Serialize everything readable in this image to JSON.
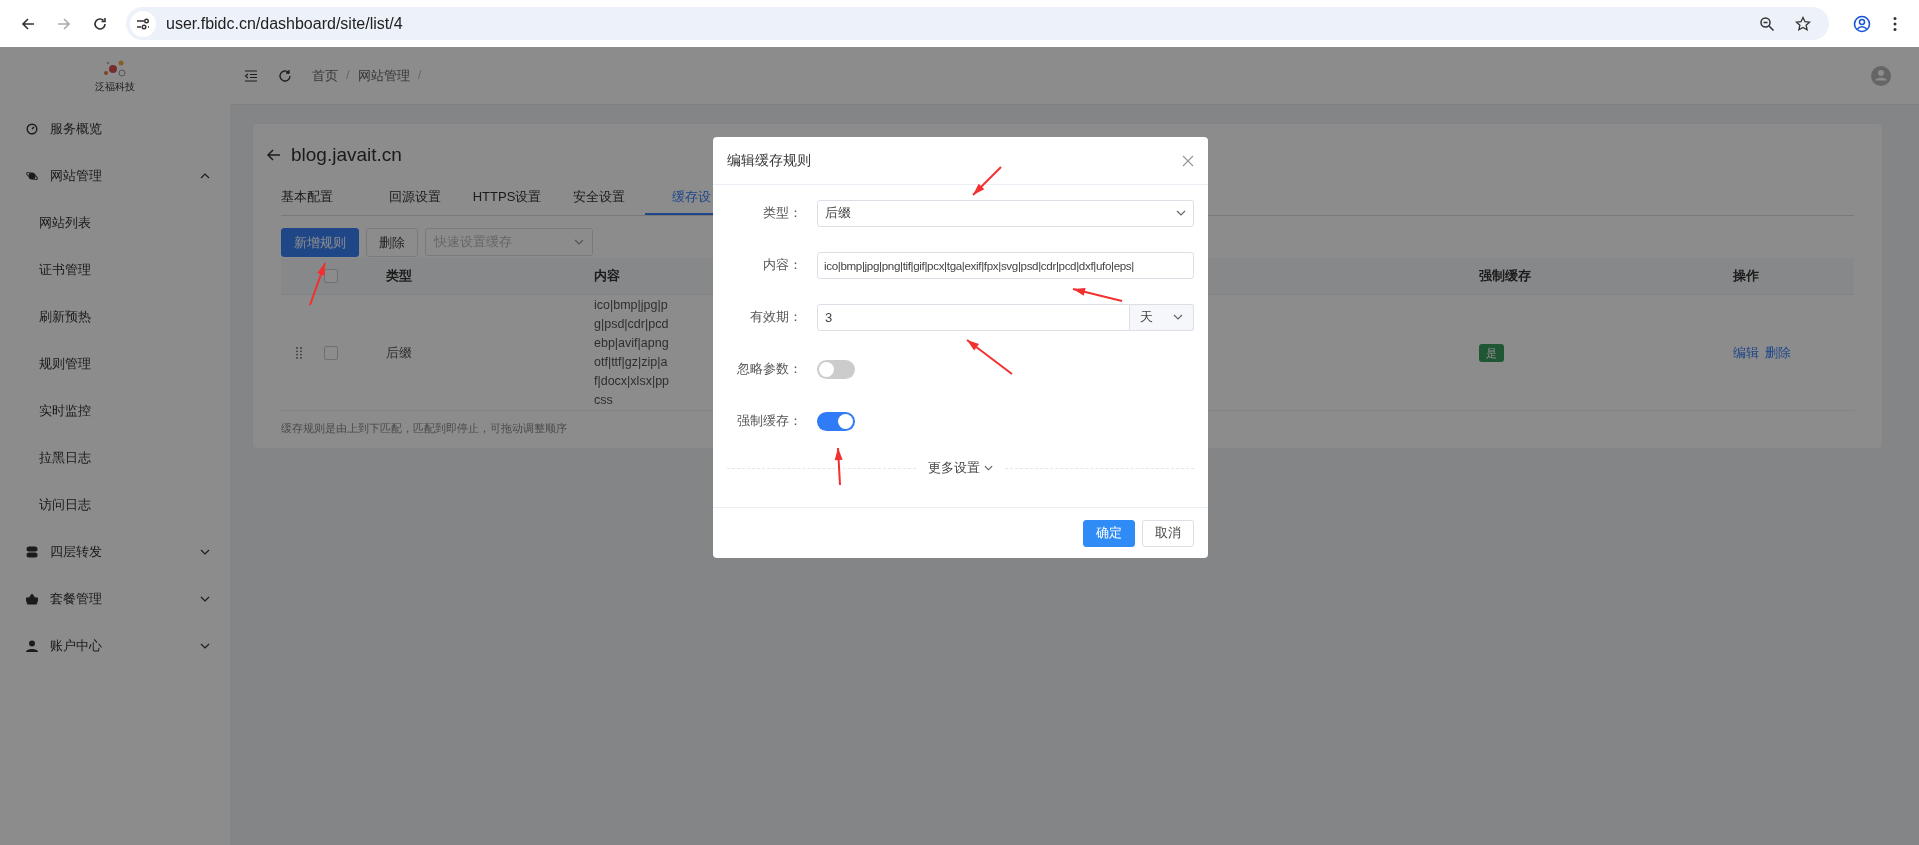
{
  "browser": {
    "url": "user.fbidc.cn/dashboard/site/list/4",
    "forward_disabled": true
  },
  "logo": {
    "text": "泛福科技"
  },
  "breadcrumb": {
    "items": [
      "首页",
      "网站管理"
    ],
    "separator": "/"
  },
  "sidebar": {
    "items": [
      {
        "label": "服务概览"
      },
      {
        "label": "网站管理",
        "expanded": true,
        "children": [
          {
            "label": "网站列表"
          },
          {
            "label": "证书管理"
          },
          {
            "label": "刷新预热"
          },
          {
            "label": "规则管理"
          },
          {
            "label": "实时监控"
          },
          {
            "label": "拉黑日志"
          },
          {
            "label": "访问日志"
          }
        ]
      },
      {
        "label": "四层转发",
        "expanded": false
      },
      {
        "label": "套餐管理",
        "expanded": false
      },
      {
        "label": "账户中心",
        "expanded": false
      }
    ]
  },
  "site": {
    "title": "blog.javait.cn"
  },
  "tabs": [
    {
      "label": "基本配置",
      "selected": false
    },
    {
      "label": "回源设置",
      "selected": false
    },
    {
      "label": "HTTPS设置",
      "selected": false
    },
    {
      "label": "安全设置",
      "selected": false
    },
    {
      "label": "缓存设",
      "selected": true
    }
  ],
  "toolbar": {
    "add_button": "新增规则",
    "delete_button": "删除",
    "quick_select": {
      "placeholder": "快速设置缓存"
    }
  },
  "table": {
    "header_checked": false,
    "columns": [
      "类型",
      "内容",
      "强制缓存",
      "操作"
    ],
    "rows": [
      {
        "checked": false,
        "type": "后缀",
        "content_lines": [
          "ico|bmp|jpg|p",
          "g|psd|cdr|pcd",
          "ebp|avif|apng",
          "otf|ttf|gz|zip|a",
          "f|docx|xlsx|pp",
          "css"
        ],
        "forced": "是",
        "actions": [
          "编辑",
          "删除"
        ]
      }
    ]
  },
  "footnote": "缓存规则是由上到下匹配，匹配到即停止，可拖动调整顺序",
  "dialog": {
    "title": "编辑缓存规则",
    "fields": [
      {
        "kind": "select",
        "label": "类型：",
        "value": "后缀"
      },
      {
        "kind": "text",
        "label": "内容：",
        "value": "ico|bmp|jpg|png|tif|gif|pcx|tga|exif|fpx|svg|psd|cdr|pcd|dxf|ufo|eps|"
      },
      {
        "kind": "duration",
        "label": "有效期：",
        "value": "3",
        "unit": "天"
      },
      {
        "kind": "switch",
        "label": "忽略参数：",
        "on": false
      },
      {
        "kind": "switch",
        "label": "强制缓存：",
        "on": true
      }
    ],
    "more": "更多设置",
    "buttons": [
      {
        "kind": "primary",
        "label": "确定"
      },
      {
        "kind": "default",
        "label": "取消"
      }
    ]
  }
}
